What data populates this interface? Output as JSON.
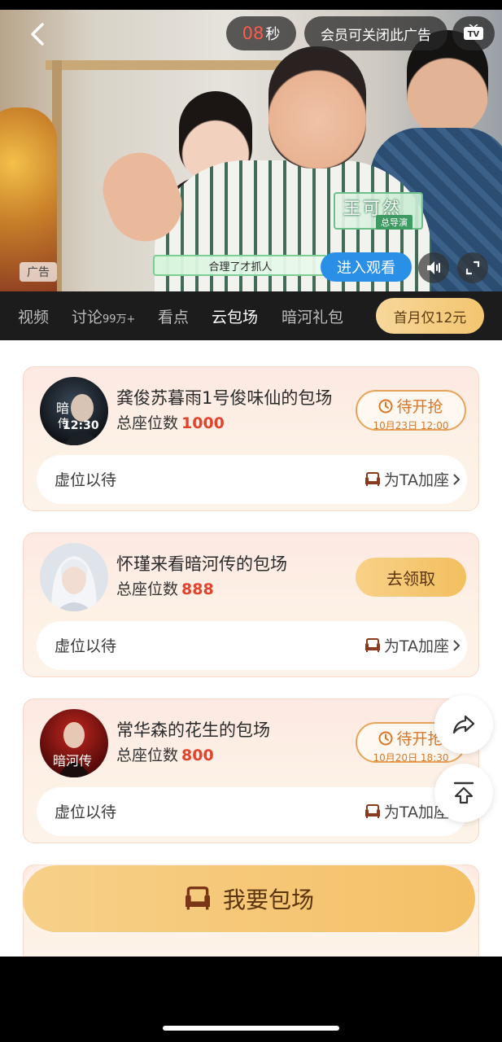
{
  "video": {
    "timer_number": "08",
    "timer_unit": "秒",
    "vip_close_ad": "会员可关闭此广告",
    "nameplate_name": "王可然",
    "nameplate_role": "总导演",
    "subtitle": "合理了才抓人",
    "enter_label": "进入观看",
    "ad_tag": "广告"
  },
  "tabs": {
    "items": [
      {
        "label": "视频"
      },
      {
        "label": "讨论",
        "count": "99万+"
      },
      {
        "label": "看点"
      },
      {
        "label": "云包场"
      },
      {
        "label": "暗河礼包"
      }
    ],
    "vip_button": "首月仅12元"
  },
  "cards": [
    {
      "title": "龚俊苏暮雨1号俊味仙的包场",
      "seats_label": "总座位数",
      "seats": "1000",
      "status_label": "待开抢",
      "status_time": "10月23日 12:00",
      "avatar_text": "12:30",
      "wait": "虚位以待",
      "add": "为TA加座"
    },
    {
      "title": "怀瑾来看暗河传的包场",
      "seats_label": "总座位数",
      "seats": "888",
      "claim_label": "去领取",
      "wait": "虚位以待",
      "add": "为TA加座"
    },
    {
      "title": "常华森的花生的包场",
      "seats_label": "总座位数",
      "seats": "800",
      "status_label": "待开抢",
      "status_time": "10月20日 18:30",
      "avatar_text": "暗河传",
      "wait": "虚位以待",
      "add": "为TA加座"
    }
  ],
  "main_button": "我要包场",
  "colors": {
    "accent_red": "#e3432c",
    "gold": "#f4c066",
    "tab_bg": "#1c1c1c"
  },
  "icons": [
    "back-icon",
    "tv-icon",
    "mute-icon",
    "fullscreen-icon",
    "clock-icon",
    "sofa-icon",
    "chevron-right-icon",
    "share-icon",
    "scroll-top-icon"
  ]
}
